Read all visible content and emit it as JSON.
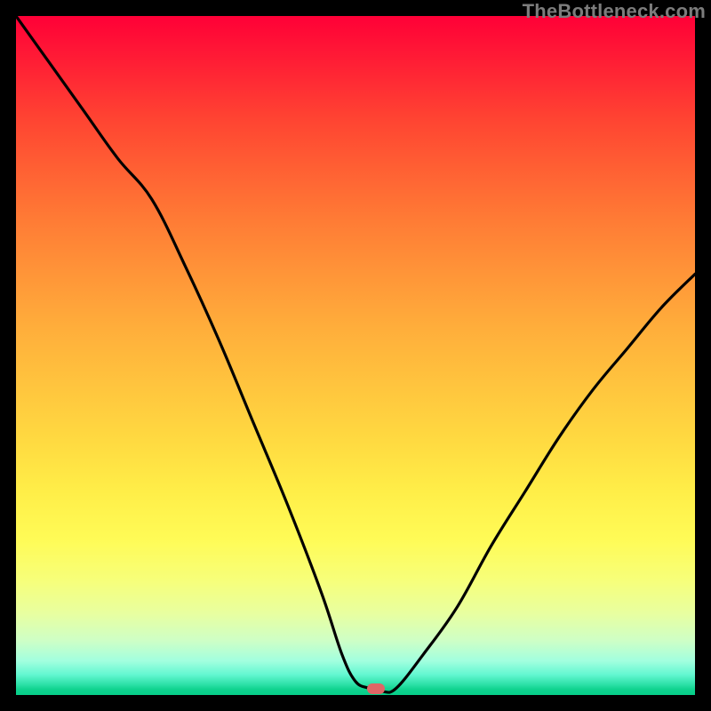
{
  "attribution": "TheBottleneck.com",
  "marker": {
    "x_pct": 53.0,
    "y_pct": 99.1
  },
  "chart_data": {
    "type": "line",
    "title": "",
    "xlabel": "",
    "ylabel": "",
    "xlim": [
      0,
      100
    ],
    "ylim": [
      0,
      100
    ],
    "series": [
      {
        "name": "bottleneck-curve",
        "x": [
          0,
          5,
          10,
          15,
          20,
          25,
          30,
          35,
          40,
          45,
          48,
          50,
          52,
          54,
          56,
          60,
          65,
          70,
          75,
          80,
          85,
          90,
          95,
          100
        ],
        "values": [
          100,
          93,
          86,
          79,
          73,
          63,
          52,
          40,
          28,
          15,
          6,
          2,
          1,
          0.5,
          1,
          6,
          13,
          22,
          30,
          38,
          45,
          51,
          57,
          62
        ]
      }
    ],
    "annotations": [
      {
        "type": "marker",
        "x": 53,
        "y": 0.9,
        "label": "optimal-point"
      }
    ],
    "background": {
      "type": "vertical-gradient",
      "stops": [
        {
          "pct": 0,
          "color": "#ff0037"
        },
        {
          "pct": 50,
          "color": "#ffbb3c"
        },
        {
          "pct": 80,
          "color": "#fffb56"
        },
        {
          "pct": 100,
          "color": "#06cf89"
        }
      ]
    }
  }
}
